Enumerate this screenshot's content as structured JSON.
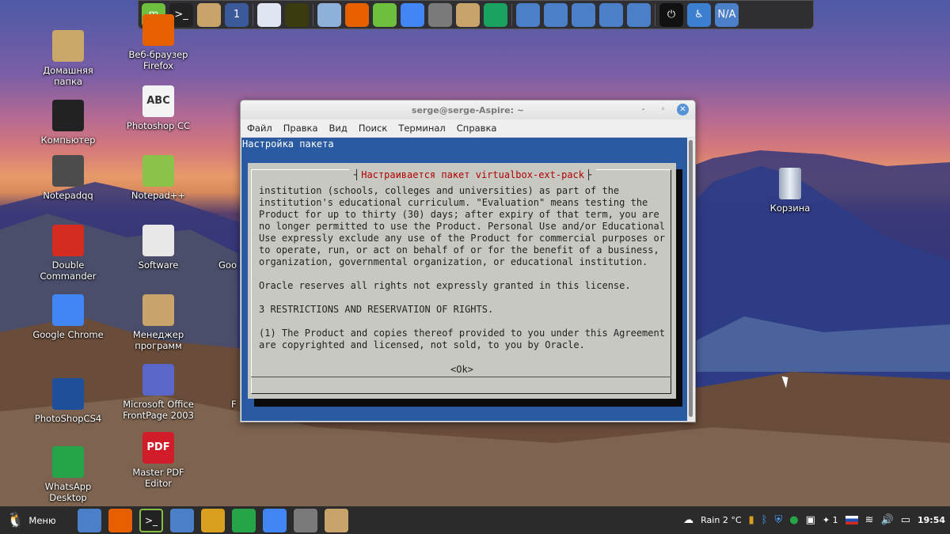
{
  "desktop": {
    "icons_col1": [
      {
        "label": "Домашняя папка",
        "icon": "home-folder-icon",
        "color": "#c9a86a"
      },
      {
        "label": "Компьютер",
        "icon": "monitor-icon",
        "color": "#222222"
      },
      {
        "label": "Notepadqq",
        "icon": "notepadqq-icon",
        "color": "#4c4c4c"
      },
      {
        "label": "Double Commander",
        "icon": "double-commander-icon",
        "color": "#d62b1f"
      },
      {
        "label": "Google Chrome",
        "icon": "chrome-icon",
        "color": "#4285f4"
      },
      {
        "label": "PhotoShopCS4",
        "icon": "photoshop-icon",
        "color": "#1f4f9a"
      },
      {
        "label": "WhatsApp Desktop",
        "icon": "whatsapp-icon",
        "color": "#25a548"
      }
    ],
    "icons_col2": [
      {
        "label": "Веб-браузер Firefox",
        "icon": "firefox-icon",
        "color": "#e66000"
      },
      {
        "label": "Photoshop CC",
        "icon": "abc-document-icon",
        "color": "#f4f4f4",
        "glyph": "ABC"
      },
      {
        "label": "Notepad++",
        "icon": "notepadpp-icon",
        "color": "#8bc34a"
      },
      {
        "label": "Software",
        "icon": "software-bag-icon",
        "color": "#e8e8e8"
      },
      {
        "label": "Менеджер программ",
        "icon": "package-manager-icon",
        "color": "#c8a46a"
      },
      {
        "label": "Microsoft Office FrontPage 2003",
        "icon": "frontpage-icon",
        "color": "#5a66c8"
      },
      {
        "label": "Master PDF Editor",
        "icon": "pdf-editor-icon",
        "color": "#d11d2a",
        "glyph": "PDF"
      }
    ],
    "trash": {
      "label": "Корзина",
      "icon": "trash-icon"
    },
    "partial_labels": [
      "Goo",
      "F"
    ]
  },
  "dock": {
    "items": [
      {
        "name": "mint-menu-icon",
        "color": "#6fbf3f",
        "glyph": "m"
      },
      {
        "name": "terminal-icon",
        "color": "#222222",
        "glyph": ">_"
      },
      {
        "name": "package-install-icon",
        "color": "#c8a46a",
        "glyph": ""
      },
      {
        "name": "workspace-switcher-icon",
        "color": "#3a5a9a",
        "glyph": "1"
      },
      {
        "name": "text-editor-icon",
        "color": "#dfe6f2",
        "glyph": ""
      },
      {
        "name": "photo-viewer-icon",
        "color": "#3b3b10",
        "glyph": ""
      },
      {
        "name": "mail-stamp-icon",
        "color": "#8fb0d8",
        "glyph": ""
      },
      {
        "name": "firefox-icon",
        "color": "#e66000",
        "glyph": ""
      },
      {
        "name": "update-manager-icon",
        "color": "#6fbf3f",
        "glyph": ""
      },
      {
        "name": "chrome-icon",
        "color": "#4285f4",
        "glyph": ""
      },
      {
        "name": "shield-icon",
        "color": "#7a7a7a",
        "glyph": ""
      },
      {
        "name": "package-manager-icon",
        "color": "#c8a46a",
        "glyph": ""
      },
      {
        "name": "vpn-icon",
        "color": "#1aa260",
        "glyph": ""
      },
      {
        "name": "home-icon",
        "color": "#4b7fc8",
        "glyph": ""
      },
      {
        "name": "folder-icon",
        "color": "#4b7fc8",
        "glyph": ""
      },
      {
        "name": "backup-icon",
        "color": "#4b7fc8",
        "glyph": ""
      },
      {
        "name": "downloads-icon",
        "color": "#4b7fc8",
        "glyph": ""
      },
      {
        "name": "desktop-icon",
        "color": "#4b7fc8",
        "glyph": ""
      },
      {
        "name": "power-icon",
        "color": "#111111",
        "glyph": "⏻"
      },
      {
        "name": "accessibility-icon",
        "color": "#3c7fd0",
        "glyph": "♿"
      },
      {
        "name": "trash-na-icon",
        "color": "#4b7fc8",
        "glyph": "N/A"
      }
    ]
  },
  "window": {
    "title": "serge@serge-Aspire: ~",
    "controls": {
      "minimize": "-",
      "maximize": "◦",
      "close": "✕"
    },
    "menu": [
      "Файл",
      "Правка",
      "Вид",
      "Поиск",
      "Терминал",
      "Справка"
    ]
  },
  "terminal": {
    "header": "Настройка пакета",
    "dialog_title": "Настраивается пакет virtualbox-ext-pack",
    "lines": [
      "institution (schools, colleges and universities) as part of the",
      "institution's educational curriculum. \"Evaluation\" means testing the",
      "Product for up to thirty (30) days; after expiry of that term, you are",
      "no longer permitted to use the Product. Personal Use and/or Educational",
      "Use expressly exclude any use of the Product for commercial purposes or",
      "to operate, run, or act on behalf of or for the benefit of a business,",
      "organization, governmental organization, or educational institution.",
      "",
      "Oracle reserves all rights not expressly granted in this license.",
      "",
      "3 RESTRICTIONS AND RESERVATION OF RIGHTS.",
      "",
      "(1) The Product and copies thereof provided to you under this Agreement",
      "are copyrighted and licensed, not sold, to you by Oracle."
    ],
    "ok_button": "<Ok>"
  },
  "taskbar": {
    "menu_label": "Меню",
    "apps": [
      {
        "name": "taskbar-desktop-icon",
        "color": "#4b7fc8",
        "active": false
      },
      {
        "name": "taskbar-firefox-icon",
        "color": "#e66000",
        "active": false
      },
      {
        "name": "taskbar-terminal-icon",
        "color": "#222222",
        "active": true,
        "glyph": ">_"
      },
      {
        "name": "taskbar-files-icon",
        "color": "#4b7fc8",
        "active": false
      },
      {
        "name": "taskbar-app-icon",
        "color": "#d9a020",
        "active": false
      },
      {
        "name": "taskbar-whatsapp-icon",
        "color": "#25a548",
        "active": false
      },
      {
        "name": "taskbar-chrome-icon",
        "color": "#4285f4",
        "active": false
      },
      {
        "name": "taskbar-shield-icon",
        "color": "#7a7a7a",
        "active": false
      },
      {
        "name": "taskbar-package-icon",
        "color": "#c8a46a",
        "active": false
      }
    ],
    "weather": "Rain 2 °C",
    "notifications_count": "1",
    "clock": "19:54"
  }
}
